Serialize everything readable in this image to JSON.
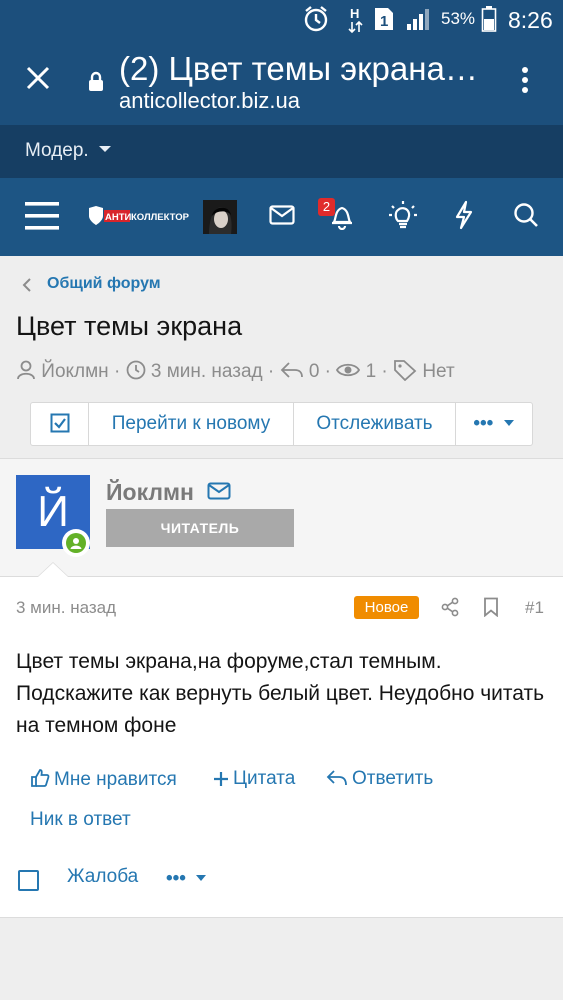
{
  "status_bar": {
    "battery_percent": "53%",
    "time": "8:26",
    "network_type": "H",
    "sim_slot": "1",
    "icons": [
      "alarm-icon",
      "network-h-icon",
      "sim-1-icon",
      "signal-icon",
      "battery-icon"
    ]
  },
  "browser": {
    "tab_title": "(2) Цвет темы экрана…",
    "domain": "anticollector.biz.ua"
  },
  "mod_bar": {
    "label": "Модер."
  },
  "nav": {
    "logo_text": "АНТИКОЛЛЕКТОР",
    "notification_count": "2",
    "icons": [
      "menu-icon",
      "envelope-icon",
      "bell-icon",
      "lightbulb-icon",
      "bolt-icon",
      "search-icon"
    ]
  },
  "breadcrumb": {
    "label": "Общий форум"
  },
  "thread": {
    "title": "Цвет темы экрана",
    "author": "Йоклмн",
    "time": "3 мин. назад",
    "replies": "0",
    "views": "1",
    "tags": "Нет"
  },
  "toolbar": {
    "goto_new_label": "Перейти к новому",
    "watch_label": "Отслеживать",
    "more_label": "•••"
  },
  "post": {
    "avatar_letter": "Й",
    "username": "Йоклмн",
    "role": "ЧИТАТЕЛЬ",
    "time": "3 мин. назад",
    "new_badge": "Новое",
    "number": "#1",
    "body": "Цвет темы экрана,на форуме,стал темным. Подскажите как вернуть белый цвет. Неудобно читать на темном фоне",
    "actions": {
      "like": "Мне нравится",
      "quote": "Цитата",
      "reply": "Ответить",
      "mention": "Ник в ответ",
      "report": "Жалоба",
      "more": "•••"
    }
  },
  "colors": {
    "header_bg": "#1c4f7c",
    "modbar_bg": "#163e63",
    "navbar_bg": "#1d5584",
    "link": "#2577b1",
    "new_badge": "#f08c00",
    "online": "#63b128",
    "avatar_bg": "#2e67c4"
  }
}
